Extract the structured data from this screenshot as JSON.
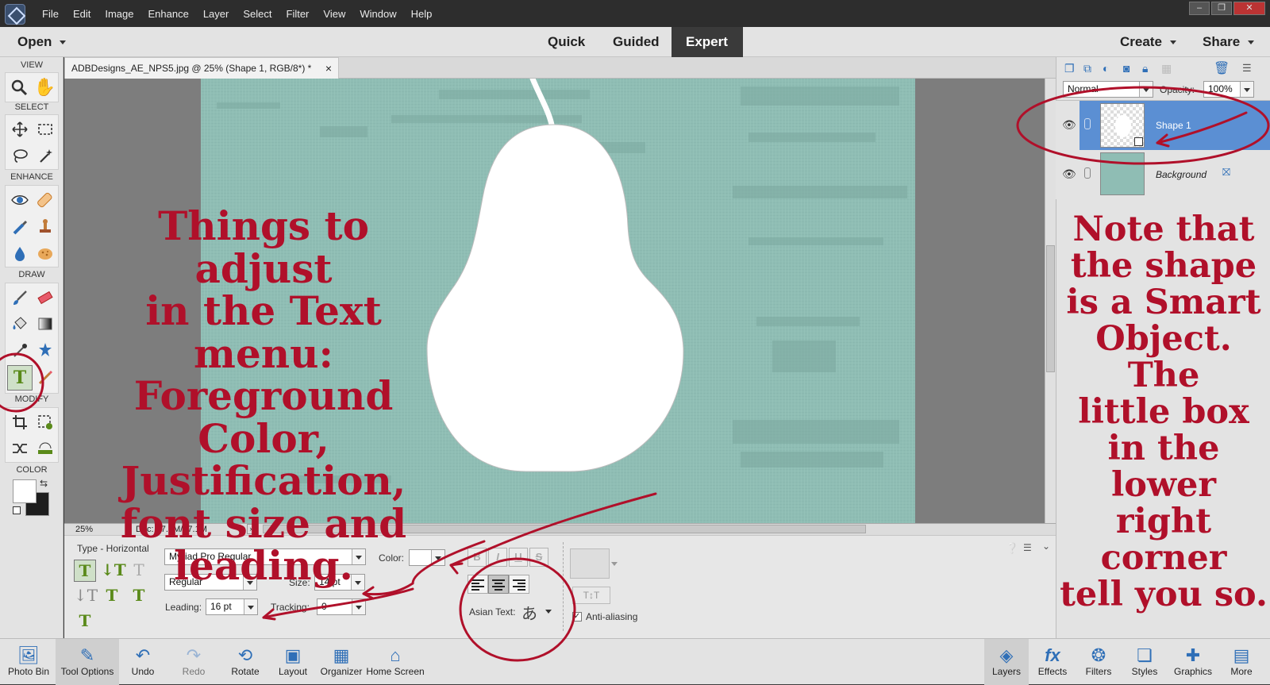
{
  "menubar": {
    "items": [
      "File",
      "Edit",
      "Image",
      "Enhance",
      "Layer",
      "Select",
      "Filter",
      "View",
      "Window",
      "Help"
    ],
    "window_controls": [
      "–",
      "❐",
      "✕"
    ]
  },
  "modebar": {
    "open_label": "Open",
    "tabs": [
      "Quick",
      "Guided",
      "Expert"
    ],
    "active_tab": "Expert",
    "create_label": "Create",
    "share_label": "Share"
  },
  "toolbox": {
    "sections": {
      "view": "VIEW",
      "select": "SELECT",
      "enhance": "ENHANCE",
      "draw": "DRAW",
      "modify": "MODIFY",
      "color": "COLOR"
    }
  },
  "document": {
    "tab_title": "ADBDesigns_AE_NPS5.jpg @ 25% (Shape 1, RGB/8*) *",
    "close_glyph": "×",
    "zoom": "25%",
    "doc_size": "Doc: 37.1M/37.1M"
  },
  "tool_options": {
    "title": "Type - Horizontal",
    "font_family": "Myriad Pro Regular",
    "font_style": "Regular",
    "color_label": "Color:",
    "size_label": "Size:",
    "size_value": "14 pt",
    "leading_label": "Leading:",
    "leading_value": "16 pt",
    "tracking_label": "Tracking:",
    "tracking_value": "0",
    "style_buttons": [
      "B",
      "I",
      "U",
      "S"
    ],
    "asian_text_label": "Asian Text:",
    "anti_aliasing_label": "Anti-aliasing",
    "anti_aliasing_checked": true
  },
  "layers": {
    "blend_mode": "Normal",
    "opacity_label": "Opacity:",
    "opacity_value": "100%",
    "items": [
      {
        "name": "Shape 1",
        "selected": true
      },
      {
        "name": "Background",
        "selected": false
      }
    ]
  },
  "bottombar": {
    "left": [
      "Photo Bin",
      "Tool Options",
      "Undo",
      "Redo",
      "Rotate",
      "Layout",
      "Organizer",
      "Home Screen"
    ],
    "right": [
      "Layers",
      "Effects",
      "Filters",
      "Styles",
      "Graphics",
      "More"
    ]
  },
  "annotations": {
    "left_note": [
      "Things to adjust",
      "in the Text menu:",
      "Foreground Color,",
      "Justification,",
      "font size and",
      "leading."
    ],
    "right_note": [
      "Note that",
      "the shape",
      "is a Smart",
      "Object. The",
      "little box",
      "in the lower",
      "right corner",
      "tell you so."
    ]
  },
  "colors": {
    "annotation": "#b0102a",
    "image_background": "#8fbdb4",
    "selected_layer": "#5b8fd3",
    "icon_blue": "#2f6fb7"
  }
}
